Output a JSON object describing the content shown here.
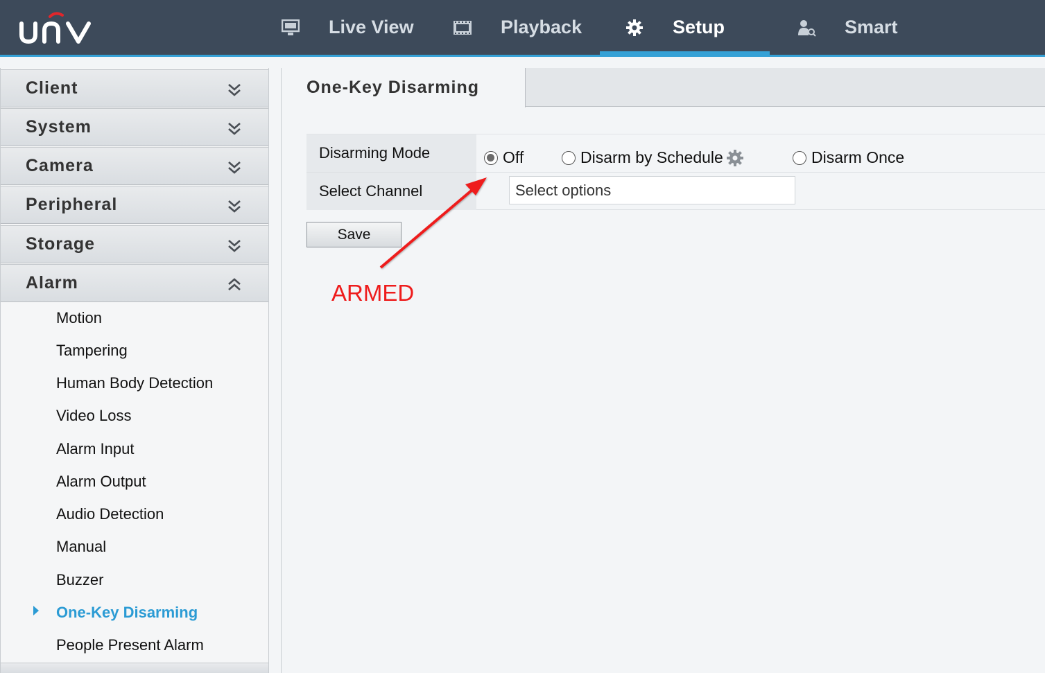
{
  "header": {
    "logo_text": "UNV",
    "nav": [
      {
        "label": "Live View",
        "icon": "monitor-icon"
      },
      {
        "label": "Playback",
        "icon": "film-icon"
      },
      {
        "label": "Setup",
        "icon": "gear-icon",
        "active": true
      },
      {
        "label": "Smart",
        "icon": "person-search-icon"
      }
    ],
    "accent_color": "#35a1d6",
    "bar_color": "#3d4a5a"
  },
  "sidebar": {
    "sections": [
      {
        "label": "Client",
        "expanded": false
      },
      {
        "label": "System",
        "expanded": false
      },
      {
        "label": "Camera",
        "expanded": false
      },
      {
        "label": "Peripheral",
        "expanded": false
      },
      {
        "label": "Storage",
        "expanded": false
      },
      {
        "label": "Alarm",
        "expanded": true
      }
    ],
    "alarm_items": [
      {
        "label": "Motion"
      },
      {
        "label": "Tampering"
      },
      {
        "label": "Human Body Detection"
      },
      {
        "label": "Video Loss"
      },
      {
        "label": "Alarm Input"
      },
      {
        "label": "Alarm Output"
      },
      {
        "label": "Audio Detection"
      },
      {
        "label": "Manual"
      },
      {
        "label": "Buzzer"
      },
      {
        "label": "One-Key Disarming",
        "active": true
      },
      {
        "label": "People Present Alarm"
      }
    ]
  },
  "main": {
    "tab_title": "One-Key Disarming",
    "disarming_mode": {
      "label": "Disarming Mode",
      "options": [
        "Off",
        "Disarm by Schedule",
        "Disarm Once"
      ],
      "selected": "Off"
    },
    "select_channel": {
      "label": "Select Channel",
      "placeholder": "Select options"
    },
    "save_label": "Save",
    "annotation": {
      "text": "ARMED",
      "color": "#ee1c1c"
    }
  }
}
